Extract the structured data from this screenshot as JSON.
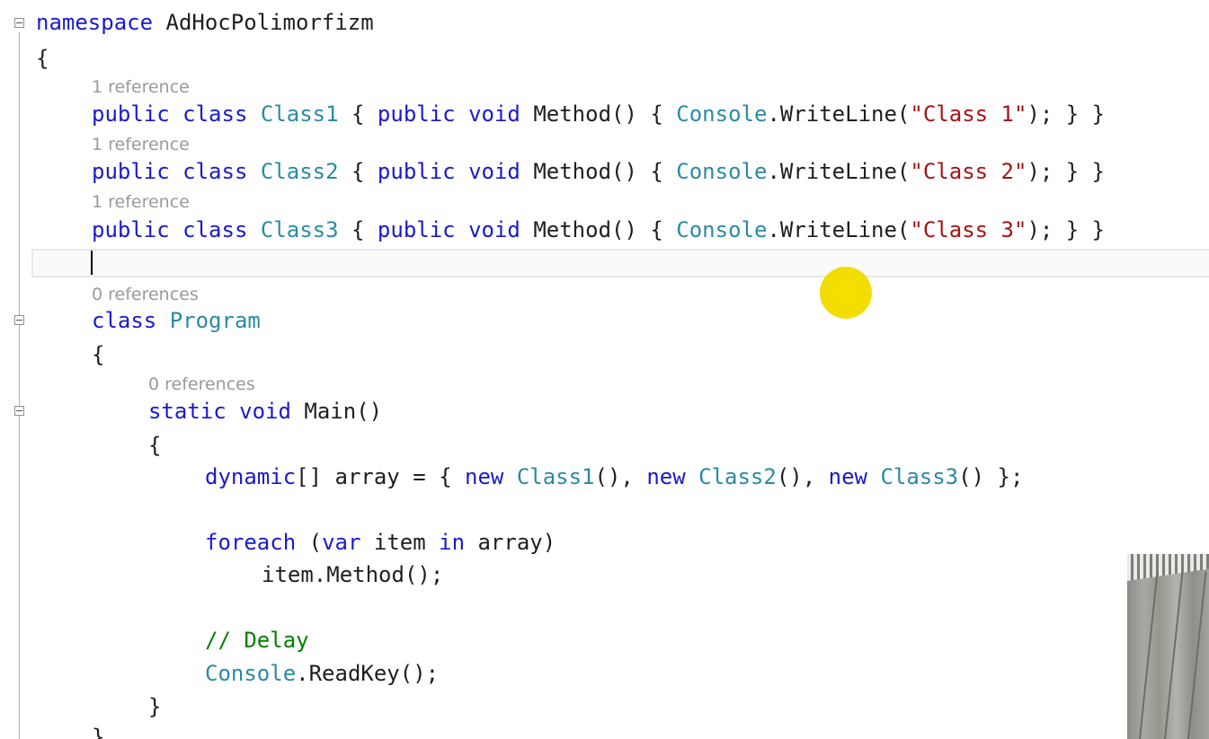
{
  "editor": {
    "namespace_keyword": "namespace",
    "namespace_name": "AdHocPolimorfizm",
    "open_brace": "{",
    "close_brace": "}",
    "classes": [
      {
        "lens": "1 reference",
        "public": "public",
        "class": "class",
        "name": "Class1",
        "brace_open": " { ",
        "public2": "public",
        "void": "void",
        "method": "Method() { ",
        "console": "Console",
        "writeline": ".WriteLine(",
        "str": "\"Class 1\"",
        "tail": "); } }"
      },
      {
        "lens": "1 reference",
        "public": "public",
        "class": "class",
        "name": "Class2",
        "brace_open": " { ",
        "public2": "public",
        "void": "void",
        "method": "Method() { ",
        "console": "Console",
        "writeline": ".WriteLine(",
        "str": "\"Class 2\"",
        "tail": "); } }"
      },
      {
        "lens": "1 reference",
        "public": "public",
        "class": "class",
        "name": "Class3",
        "brace_open": " { ",
        "public2": "public",
        "void": "void",
        "method": "Method() { ",
        "console": "Console",
        "writeline": ".WriteLine(",
        "str": "\"Class 3\"",
        "tail": "); } }"
      }
    ],
    "program": {
      "lens": "0 references",
      "class_kw": "class",
      "name": "Program",
      "open_brace": "{",
      "close_brace": "}"
    },
    "main": {
      "lens": "0 references",
      "static": "static",
      "void": "void",
      "signature": "Main()",
      "open_brace": "{",
      "close_brace": "}"
    },
    "body": {
      "dynamic": "dynamic",
      "array_decl": "[] array = { ",
      "new1": "new",
      "type1": "Class1",
      "sep1": "(), ",
      "new2": "new",
      "type2": "Class2",
      "sep2": "(), ",
      "new3": "new",
      "type3": "Class3",
      "end": "() };",
      "foreach": "foreach",
      "paren_open": " (",
      "var": "var",
      "item": " item ",
      "in": "in",
      "array_close": " array)",
      "call": "item.Method();",
      "comment": "// Delay",
      "console": "Console",
      "readkey": ".ReadKey();"
    }
  },
  "colors": {
    "keyword": "#1a1acc",
    "type": "#2b8aa3",
    "string": "#a31515",
    "comment": "#008000",
    "code_lens": "#9a9a9a",
    "cursor_highlight": "#f3dc00"
  }
}
